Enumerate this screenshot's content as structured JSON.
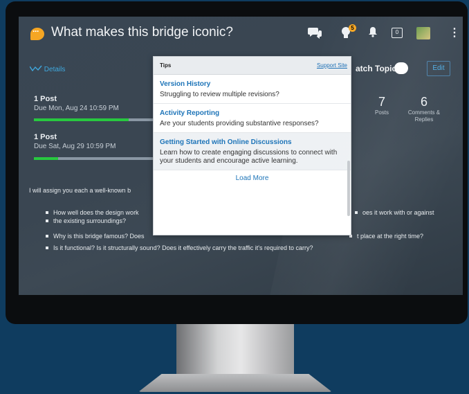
{
  "header": {
    "title": "What makes this bridge iconic?",
    "notification_count": "5",
    "calendar_day": "0"
  },
  "subbar": {
    "details_label": "Details",
    "watch_label": "atch Topic",
    "edit_label": "Edit"
  },
  "requirements": [
    {
      "label": "1 Post",
      "due": "Due Mon, Aug 24 10:59 PM",
      "progress": 0.78
    },
    {
      "label": "1 Post",
      "due": "Due Sat, Aug 29 10:59 PM",
      "progress": 0.2
    }
  ],
  "stats": [
    {
      "value": "7",
      "label": "Posts"
    },
    {
      "value": "6",
      "label": "Comments & Replies"
    }
  ],
  "prompt": {
    "intro": "I will assign you each a well-known b",
    "bullets": [
      {
        "left": "How well does the design work",
        "right": "oes it work with or against",
        "line2": "the existing surroundings?"
      },
      {
        "left": "Why is this bridge famous? Does",
        "right": "t place at the right time?",
        "line2": ""
      },
      {
        "left": "Is it functional? Is it structurally sound? Does it effectively carry the traffic it's required to carry?",
        "right": "",
        "line2": ""
      }
    ]
  },
  "tips": {
    "title": "Tips",
    "support_link": "Support Site",
    "items": [
      {
        "heading": "Version History",
        "desc": "Struggling to review multiple revisions?"
      },
      {
        "heading": "Activity Reporting",
        "desc": "Are your students providing substantive responses?"
      },
      {
        "heading": "Getting Started with Online Discussions",
        "desc": "Learn how to create engaging discussions to connect with your students and encourage active learning."
      }
    ],
    "load_more": "Load More"
  },
  "colors": {
    "page_bg": "#0f3c5f",
    "screen_bg": "#394653",
    "accent_link": "#1d74b8",
    "progress_green": "#28c840",
    "badge_orange": "#f5a623"
  },
  "icons": [
    "chat-logo-icon",
    "discussion-icon",
    "lightbulb-icon",
    "bell-icon",
    "calendar-icon",
    "avatar",
    "more-vertical-icon",
    "activity-icon"
  ]
}
